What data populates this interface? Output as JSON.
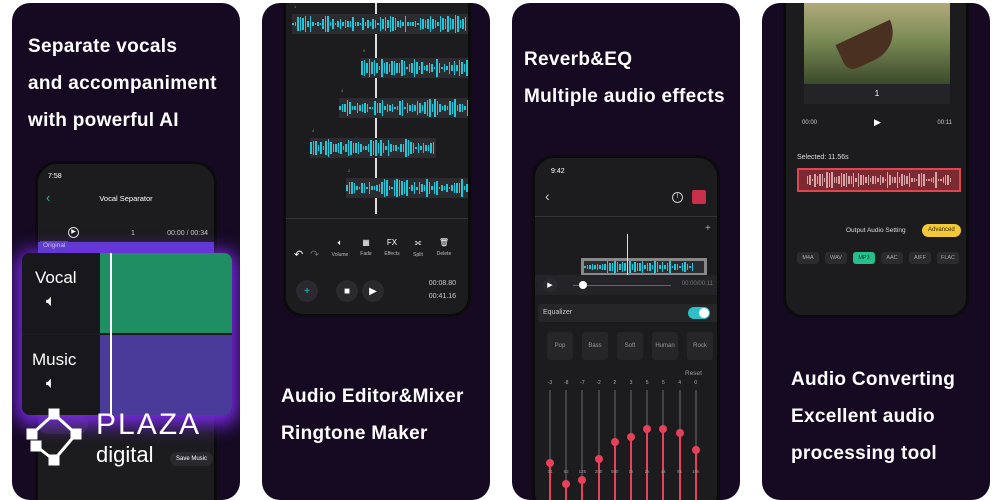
{
  "panel1": {
    "caption": [
      "Separate vocals",
      "and accompaniment",
      "with powerful AI"
    ],
    "phone": {
      "time": "7:58",
      "title": "Vocal Separator",
      "page": "1",
      "timecode": "00:00 / 00:34",
      "original_label": "Original",
      "save_music": "Save Music"
    },
    "tracks": [
      {
        "label": "Vocal",
        "color": "#1f8f63"
      },
      {
        "label": "Music",
        "color": "#4a3a9a"
      }
    ]
  },
  "logo": {
    "line1": "PLAZA",
    "line2": "digital"
  },
  "panel2": {
    "track_numbers": [
      "1",
      "5",
      "4",
      "4",
      "2"
    ],
    "tools": [
      "Volume",
      "Fade",
      "Effects",
      "Split",
      "Delete"
    ],
    "time_current": "00:08.80",
    "time_total": "00:41.16",
    "caption": [
      "Audio Editor&Mixer",
      "Ringtone Maker"
    ]
  },
  "panel3": {
    "caption": [
      "Reverb&EQ",
      "Multiple audio effects"
    ],
    "phone": {
      "time": "9:42",
      "timecode": "00:00/00:11",
      "equalizer_label": "Equalizer",
      "equalizer_on": true,
      "presets": [
        "Pop",
        "Bass",
        "Soft",
        "Human",
        "Rock"
      ],
      "reset": "Reset",
      "eq_gains": [
        -3,
        -8,
        -7,
        -2,
        2,
        3,
        5,
        5,
        4,
        0
      ],
      "eq_bands": [
        "31",
        "62",
        "125",
        "250",
        "500",
        "1k",
        "2k",
        "4k",
        "8k",
        "16k"
      ]
    },
    "accent": "#e8405a"
  },
  "panel4": {
    "page": "1",
    "time_start": "00:00",
    "time_end": "00:11",
    "selected": "Selected: 11.56s",
    "output_setting": "Output Audio Setting",
    "advanced": "Advanced",
    "formats": [
      "M4A",
      "WAV",
      "MP3",
      "AAC",
      "AIFF",
      "FLAC"
    ],
    "selected_format": "MP3",
    "caption": [
      "Audio Converting",
      "Excellent audio",
      "processing tool"
    ]
  }
}
